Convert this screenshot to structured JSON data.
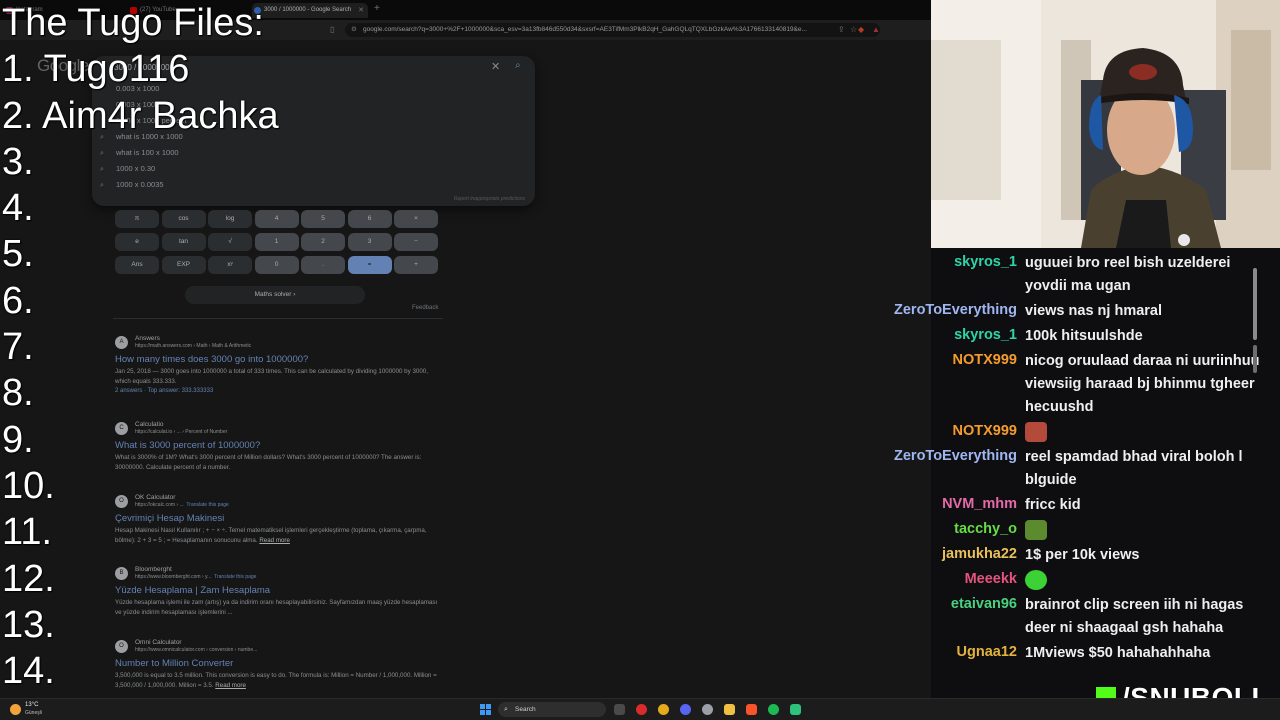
{
  "browser": {
    "tabs": [
      {
        "label": "Instagram"
      },
      {
        "label": "(27) YouTube"
      },
      {
        "label": "3000 / 1000000 - Google Search"
      }
    ],
    "url": "google.com/search?q=3000+%2F+1000000&sca_esv=3a13fb846d550d34&sxsrf=AE3TifMm3PlkB2qH_GahGQLqTQXLbGzkAw%3A1766133140819&e..."
  },
  "search": {
    "logo": "Google",
    "query": "3000 / 1000000",
    "suggestions": [
      "0.003 x 1000",
      "0.003 x 1000",
      "0.003 x 1000 percent",
      "what is 1000 x 1000",
      "what is 100 x 1000",
      "1000 x 0.30",
      "1000 x 0.0035"
    ],
    "report": "Report inappropriate predictions"
  },
  "calculator": {
    "keys": [
      {
        "label": "π",
        "kind": "fn"
      },
      {
        "label": "cos",
        "kind": "fn"
      },
      {
        "label": "log",
        "kind": "fn"
      },
      {
        "label": "4",
        "kind": "num"
      },
      {
        "label": "5",
        "kind": "num"
      },
      {
        "label": "6",
        "kind": "num"
      },
      {
        "label": "×",
        "kind": "op"
      },
      {
        "label": "e",
        "kind": "fn"
      },
      {
        "label": "tan",
        "kind": "fn"
      },
      {
        "label": "√",
        "kind": "fn"
      },
      {
        "label": "1",
        "kind": "num"
      },
      {
        "label": "2",
        "kind": "num"
      },
      {
        "label": "3",
        "kind": "num"
      },
      {
        "label": "−",
        "kind": "op"
      },
      {
        "label": "Ans",
        "kind": "fn"
      },
      {
        "label": "EXP",
        "kind": "fn"
      },
      {
        "label": "xʸ",
        "kind": "fn"
      },
      {
        "label": "0",
        "kind": "num"
      },
      {
        "label": ".",
        "kind": "num"
      },
      {
        "label": "=",
        "kind": "eq"
      },
      {
        "label": "+",
        "kind": "op"
      }
    ],
    "maths_solver": "Maths solver",
    "feedback": "Feedback"
  },
  "results": [
    {
      "site": "Answers",
      "url": "https://math.answers.com › Math › Math & Arithmetic",
      "title": "How many times does 3000 go into 1000000?",
      "snippet": "Jan 25, 2018 — 3000 goes into 1000000 a total of 333 times. This can be calculated by dividing 1000000 by 3000, which equals 333.333.",
      "extra": "2 answers · Top answer: 333.333333",
      "icon": "A"
    },
    {
      "site": "Calculatio",
      "url": "https://calculat.io › ... › Percent of Number",
      "title": "What is 3000 percent of 1000000?",
      "snippet": "What is 3000% of 1M? What's 3000 percent of Million dollars? What's 3000 percent of 1000000? The answer is: 30000000. Calculate percent of a number.",
      "extra": "",
      "icon": "C"
    },
    {
      "site": "OK Calculator",
      "url": "https://okcalc.com › ...",
      "translate": "Translate this page",
      "title": "Çevrimiçi Hesap Makinesi",
      "snippet": "Hesap Makinesi Nasıl Kullanılır ; + − × ÷. Temel matematiksel işlemleri gerçekleştirme (toplama, çıkarma, çarpma, bölme): 2 + 3 = 5 ; = Hesaplamanın sonucunu alma.",
      "read_more": "Read more",
      "extra": "",
      "icon": "O"
    },
    {
      "site": "Bloomberght",
      "url": "https://www.bloomberght.com › y...",
      "translate": "Translate this page",
      "title": "Yüzde Hesaplama | Zam Hesaplama",
      "snippet": "Yüzde hesaplama işlemi ile zam (artış) ya da indirim oranı hesaplayabilirsiniz. Sayfamızdan maaş yüzde hesaplaması ve yüzde indirim hesaplaması işlemlerini ...",
      "extra": "",
      "icon": "B"
    },
    {
      "site": "Omni Calculator",
      "url": "https://www.omnicalculator.com › conversion › numbe...",
      "title": "Number to Million Converter",
      "snippet": "3,500,000 is equal to 3.5 million. This conversion is easy to do. The formula is: Million = Number / 1,000,000. Million = 3,500,000 / 1,000,000. Million = 3.5.",
      "read_more": "Read more",
      "extra": "",
      "icon": "O"
    }
  ],
  "overlay": {
    "title": "The Tugo Files:",
    "entries": [
      "1. Tugo116",
      "2. Aim4r Bachka",
      "3.",
      "4.",
      "5.",
      "6.",
      "7.",
      "8.",
      "9.",
      "10.",
      "11.",
      "12.",
      "13.",
      "14."
    ]
  },
  "chat": [
    {
      "user": "skyros_1",
      "color": "#2fd3a8",
      "text": "uguuei bro reel bish uzelderei yovdii ma ugan",
      "lines": 2
    },
    {
      "user": "ZeroToEverything",
      "color": "#9fb6f0",
      "text": "views nas nj hmaral",
      "lines": 1
    },
    {
      "user": "skyros_1",
      "color": "#2fd3a8",
      "text": "100k hitsuulshde",
      "lines": 1
    },
    {
      "user": "NOTX999",
      "color": "#f59c2d",
      "text": "nicog oruulaad daraa ni uuriinhuu viewsiig haraad bj bhinmu tgheer hecuushd",
      "lines": 3
    },
    {
      "user": "NOTX999",
      "color": "#f59c2d",
      "text": "",
      "emote": "face-emote",
      "lines": 1
    },
    {
      "user": "ZeroToEverything",
      "color": "#9fb6f0",
      "text": "reel spamdad bhad viral boloh l blguide",
      "lines": 2
    },
    {
      "user": "NVM_mhm",
      "color": "#e46aa9",
      "text": "fricc kid",
      "lines": 1
    },
    {
      "user": "tacchy_o",
      "color": "#66dd44",
      "text": "",
      "emote": "frog-emote",
      "lines": 1
    },
    {
      "user": "jamukha22",
      "color": "#e9c15a",
      "text": "1$ per 10k views",
      "lines": 1
    },
    {
      "user": "Meeekk",
      "color": "#e5537f",
      "text": "",
      "emote": "green-blob-emote",
      "lines": 1
    },
    {
      "user": "etaivan96",
      "color": "#49d07e",
      "text": "brainrot clip screen iih ni hagas deer ni shaagaal gsh hahaha",
      "lines": 2
    },
    {
      "user": "Ugnaa12",
      "color": "#e3b33d",
      "text": "1Mviews $50 hahahahhaha",
      "lines": 1
    }
  ],
  "taskbar": {
    "temp": "13°C",
    "weather": "Güneşli",
    "search": "Search"
  },
  "brand": {
    "text": "/SNUBOLI"
  }
}
